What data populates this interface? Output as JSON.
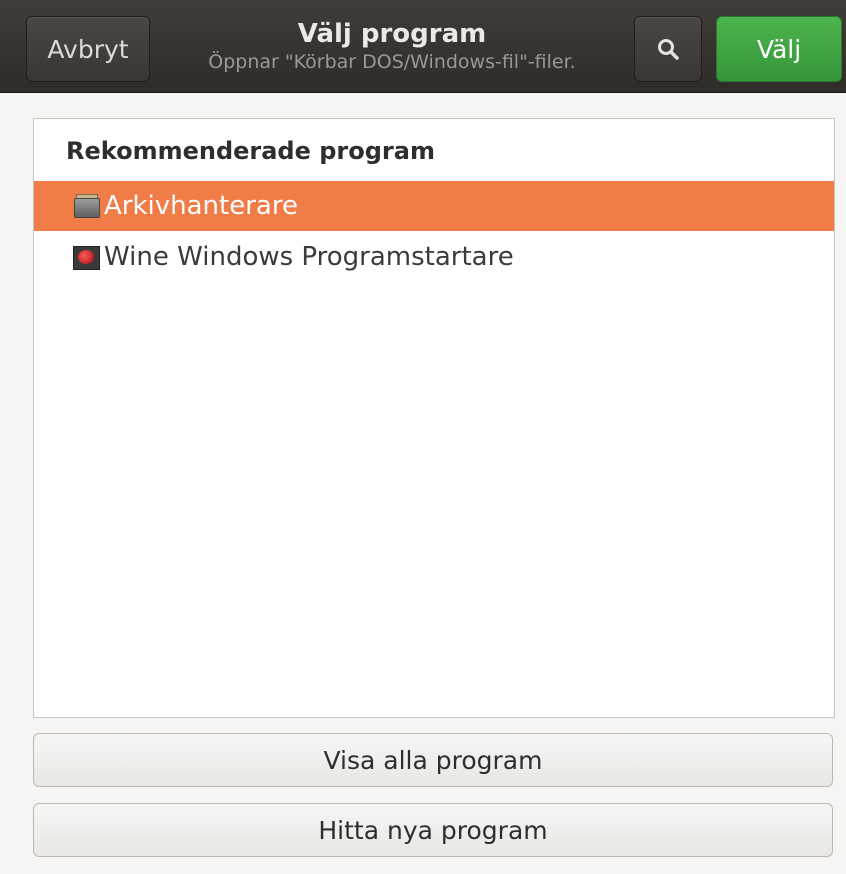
{
  "header": {
    "title": "Välj program",
    "subtitle": "Öppnar \"Körbar DOS/Windows-fil\"-filer.",
    "cancel_label": "Avbryt",
    "select_label": "Välj",
    "search_icon": "search-icon",
    "accent_color": "#3ea443"
  },
  "list": {
    "heading": "Rekommenderade program",
    "items": [
      {
        "label": "Arkivhanterare",
        "icon": "archive-manager-icon",
        "selected": true
      },
      {
        "label": "Wine Windows Programstartare",
        "icon": "wine-icon",
        "selected": false
      }
    ],
    "selection_color": "#f07c48"
  },
  "footer": {
    "show_all_label": "Visa alla program",
    "find_new_label": "Hitta nya program"
  }
}
